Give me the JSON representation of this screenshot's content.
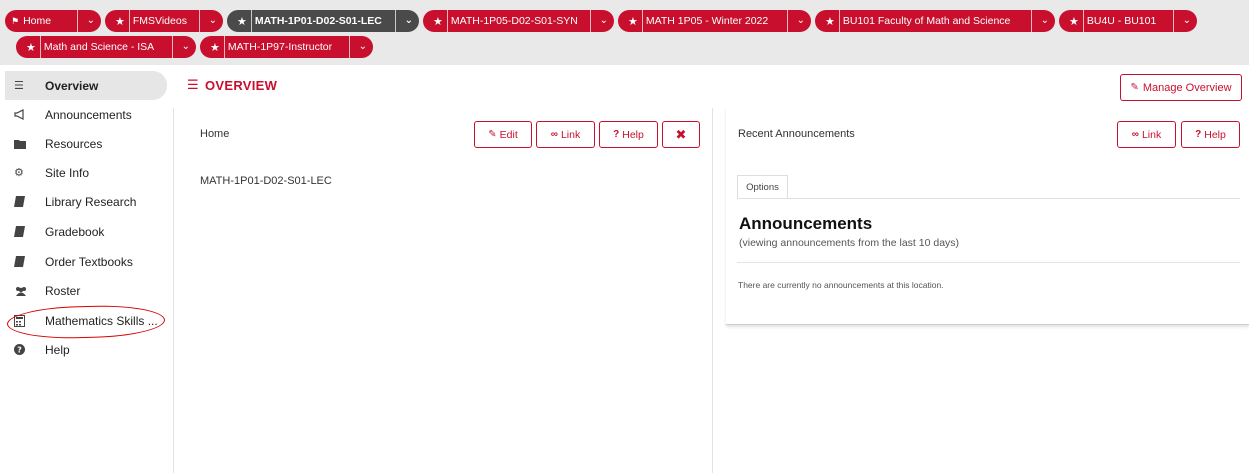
{
  "site_tabs": [
    {
      "label": "Home",
      "icon": "home-icon",
      "active": false
    },
    {
      "label": "FMSVideos",
      "icon": "star-icon",
      "active": false
    },
    {
      "label": "MATH-1P01-D02-S01-LEC",
      "icon": "star-icon",
      "active": true
    },
    {
      "label": "MATH-1P05-D02-S01-SYN",
      "icon": "star-icon",
      "active": false
    },
    {
      "label": "MATH 1P05 - Winter 2022",
      "icon": "star-icon",
      "active": false
    },
    {
      "label": "BU101 Faculty of Math and Science",
      "icon": "star-icon",
      "active": false
    },
    {
      "label": "BU4U - BU101",
      "icon": "star-icon",
      "active": false
    },
    {
      "label": "Math and Science - ISA",
      "icon": "star-icon",
      "active": false
    },
    {
      "label": "MATH-1P97-Instructor",
      "icon": "star-icon",
      "active": false
    }
  ],
  "sidebar": {
    "items": [
      {
        "label": "Overview",
        "icon": "list-icon",
        "selected": true
      },
      {
        "label": "Announcements",
        "icon": "megaphone-icon",
        "selected": false
      },
      {
        "label": "Resources",
        "icon": "folder-icon",
        "selected": false
      },
      {
        "label": "Site Info",
        "icon": "gear-icon",
        "selected": false
      },
      {
        "label": "Library Research",
        "icon": "book-icon",
        "selected": false
      },
      {
        "label": "Gradebook",
        "icon": "book-icon",
        "selected": false
      },
      {
        "label": "Order Textbooks",
        "icon": "book-icon",
        "selected": false
      },
      {
        "label": "Roster",
        "icon": "users-icon",
        "selected": false
      },
      {
        "label": "Mathematics Skills ...",
        "icon": "calculator-icon",
        "selected": false
      },
      {
        "label": "Help",
        "icon": "question-circle-icon",
        "selected": false
      }
    ]
  },
  "main": {
    "title": "OVERVIEW",
    "manage_label": "Manage Overview",
    "home_panel": {
      "title": "Home",
      "edit_label": "Edit",
      "link_label": "Link",
      "help_label": "Help",
      "site_name": "MATH-1P01-D02-S01-LEC"
    },
    "announcements_panel": {
      "title": "Recent Announcements",
      "link_label": "Link",
      "help_label": "Help",
      "options_tab": "Options",
      "heading": "Announcements",
      "subheading": "(viewing announcements from the last 10 days)",
      "empty_message": "There are currently no announcements at this location."
    }
  },
  "colors": {
    "accent": "#c8102e",
    "active_tab": "#4a4a4a",
    "annotation_circle": "#d40000"
  }
}
